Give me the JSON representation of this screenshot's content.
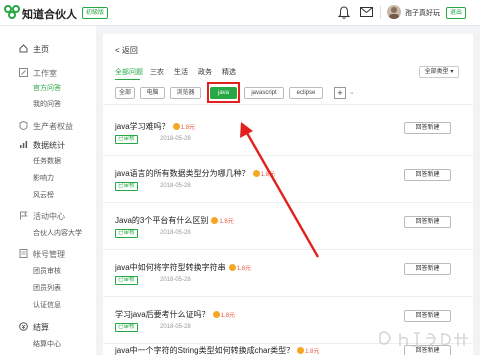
{
  "header": {
    "brand": "知道合伙人",
    "beta_badge": "初級版",
    "username": "孢子真好玩",
    "logout": "退出"
  },
  "sidebar": {
    "items": [
      {
        "label": "主页",
        "icon": "home-icon",
        "level": "top"
      },
      {
        "label": "工作室",
        "icon": "edit-icon",
        "level": "top",
        "muted": true
      },
      {
        "label": "官方问答",
        "level": "sub",
        "active": true
      },
      {
        "label": "我的问答",
        "level": "sub"
      },
      {
        "label": "生产者权益",
        "icon": "shield-icon",
        "level": "top",
        "muted": true
      },
      {
        "label": "数据统计",
        "icon": "chart-icon",
        "level": "top"
      },
      {
        "label": "任务数据",
        "level": "sub"
      },
      {
        "label": "影响力",
        "level": "sub"
      },
      {
        "label": "风云榜",
        "level": "sub"
      },
      {
        "label": "活动中心",
        "icon": "flag-icon",
        "level": "top",
        "muted": true
      },
      {
        "label": "合伙人内容大学",
        "level": "sub"
      },
      {
        "label": "帐号管理",
        "icon": "doc-icon",
        "level": "top",
        "muted": true
      },
      {
        "label": "团员审核",
        "level": "sub"
      },
      {
        "label": "团员列表",
        "level": "sub"
      },
      {
        "label": "认证信息",
        "level": "sub"
      },
      {
        "label": "结算",
        "icon": "settle-icon",
        "level": "top"
      },
      {
        "label": "结算中心",
        "level": "sub"
      }
    ]
  },
  "main": {
    "back_label": "返回",
    "tabs": [
      {
        "label": "全部问题",
        "active": true
      },
      {
        "label": "三农"
      },
      {
        "label": "生活"
      },
      {
        "label": "政务"
      },
      {
        "label": "精选"
      }
    ],
    "sort_select": "全部类型",
    "chips": [
      {
        "label": "全部"
      },
      {
        "label": "电脑"
      },
      {
        "label": "浏览器"
      },
      {
        "label": "java",
        "active": true
      },
      {
        "label": "javascript"
      },
      {
        "label": "eclipse"
      }
    ],
    "plus_label": "+",
    "questions": [
      {
        "title": "java学习难吗？",
        "reward": "1.8元",
        "tag": "已审核",
        "date": "2018-05-28",
        "button": "回答新建"
      },
      {
        "title": "java语言的所有数据类型分为哪几种？",
        "reward": "1.8元",
        "tag": "已审核",
        "date": "2018-05-28",
        "button": "回答新建"
      },
      {
        "title": "Java的3个平台有什么区别",
        "reward": "1.8元",
        "tag": "已审核",
        "date": "2018-05-28",
        "button": "回答新建"
      },
      {
        "title": "java中如何将字符型转换字符串",
        "reward": "1.8元",
        "tag": "已审核",
        "date": "2018-05-28",
        "button": "回答新建"
      },
      {
        "title": "学习java后要考什么证吗？",
        "reward": "1.8元",
        "tag": "已审核",
        "date": "2018-05-28",
        "button": "回答新建"
      },
      {
        "title": "java中一个字符的String类型如何转换成char类型？",
        "reward": "1.8元",
        "tag": "已审核",
        "date": "2018-05-28",
        "button": "回答新建"
      }
    ]
  },
  "colors": {
    "accent": "#27a844",
    "annotation": "#e2211c",
    "reward": "#e8573c",
    "coin": "#f5a623"
  }
}
